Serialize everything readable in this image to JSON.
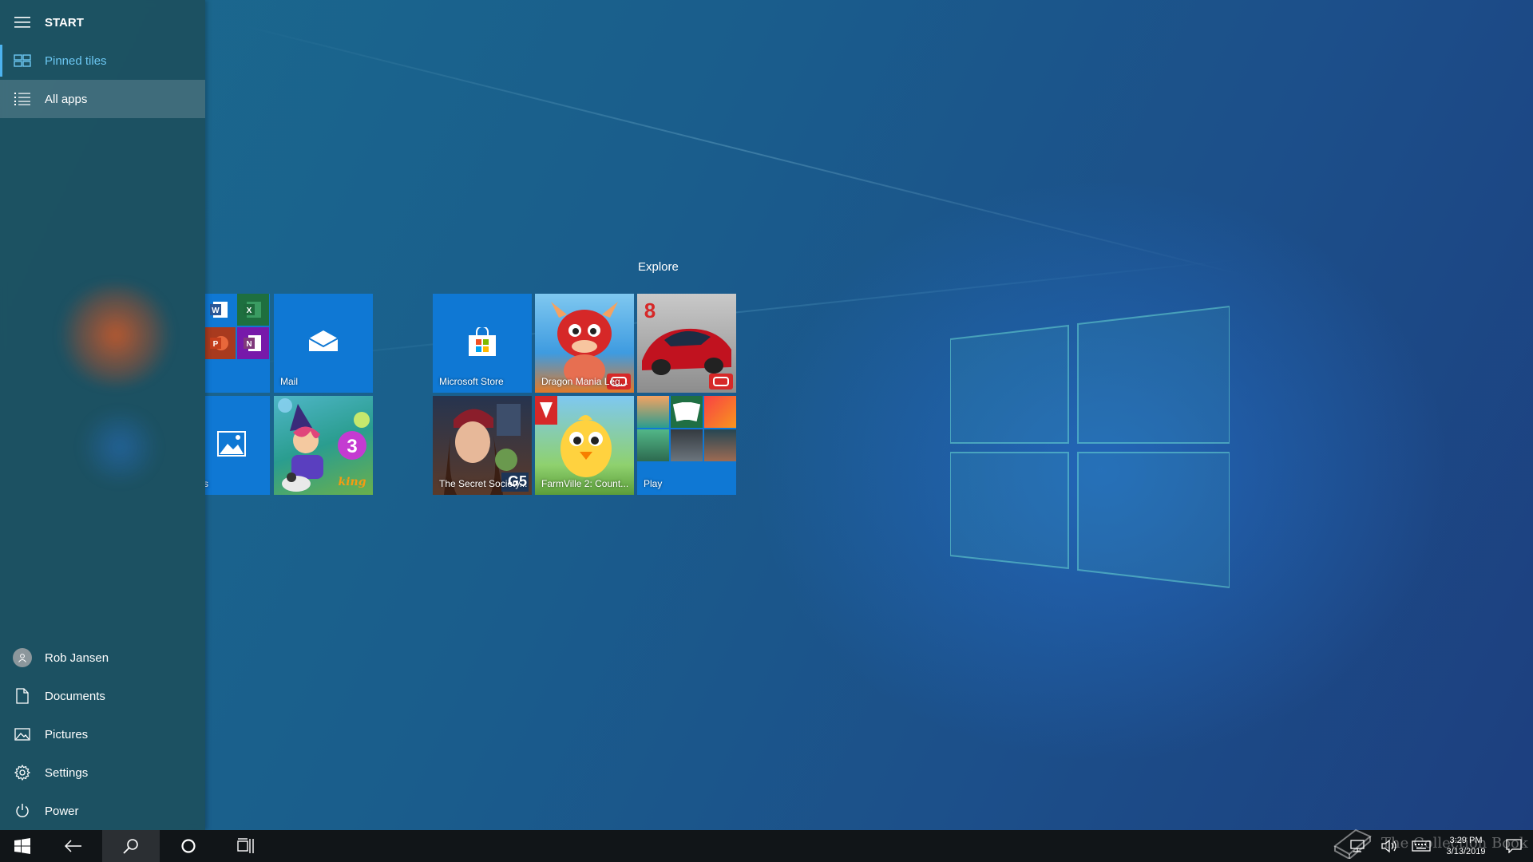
{
  "start_menu": {
    "header": "START",
    "pinned_tiles_label": "Pinned tiles",
    "all_apps_label": "All apps",
    "user_name": "Rob Jansen",
    "documents_label": "Documents",
    "pictures_label": "Pictures",
    "settings_label": "Settings",
    "power_label": "Power"
  },
  "tiles": {
    "group_explore": "Explore",
    "mail": "Mail",
    "photos_partial": "s",
    "microsoft_store": "Microsoft Store",
    "dragon_mania": "Dragon Mania Leg...",
    "asphalt_badge": "8",
    "secret_society": "The Secret Society...",
    "secret_society_badge": "G5",
    "farmville": "FarmVille 2: Count...",
    "play": "Play"
  },
  "office_icons": {
    "word": "W",
    "excel": "X",
    "powerpoint": "P",
    "onenote": "N"
  },
  "taskbar": {
    "time": "3:29 PM",
    "date": "3/13/2019"
  },
  "watermark": "The Collection Book",
  "colors": {
    "accent": "#0f78d4",
    "pinned_highlight": "#6cc7f2",
    "taskbar_bg": "#111518"
  }
}
